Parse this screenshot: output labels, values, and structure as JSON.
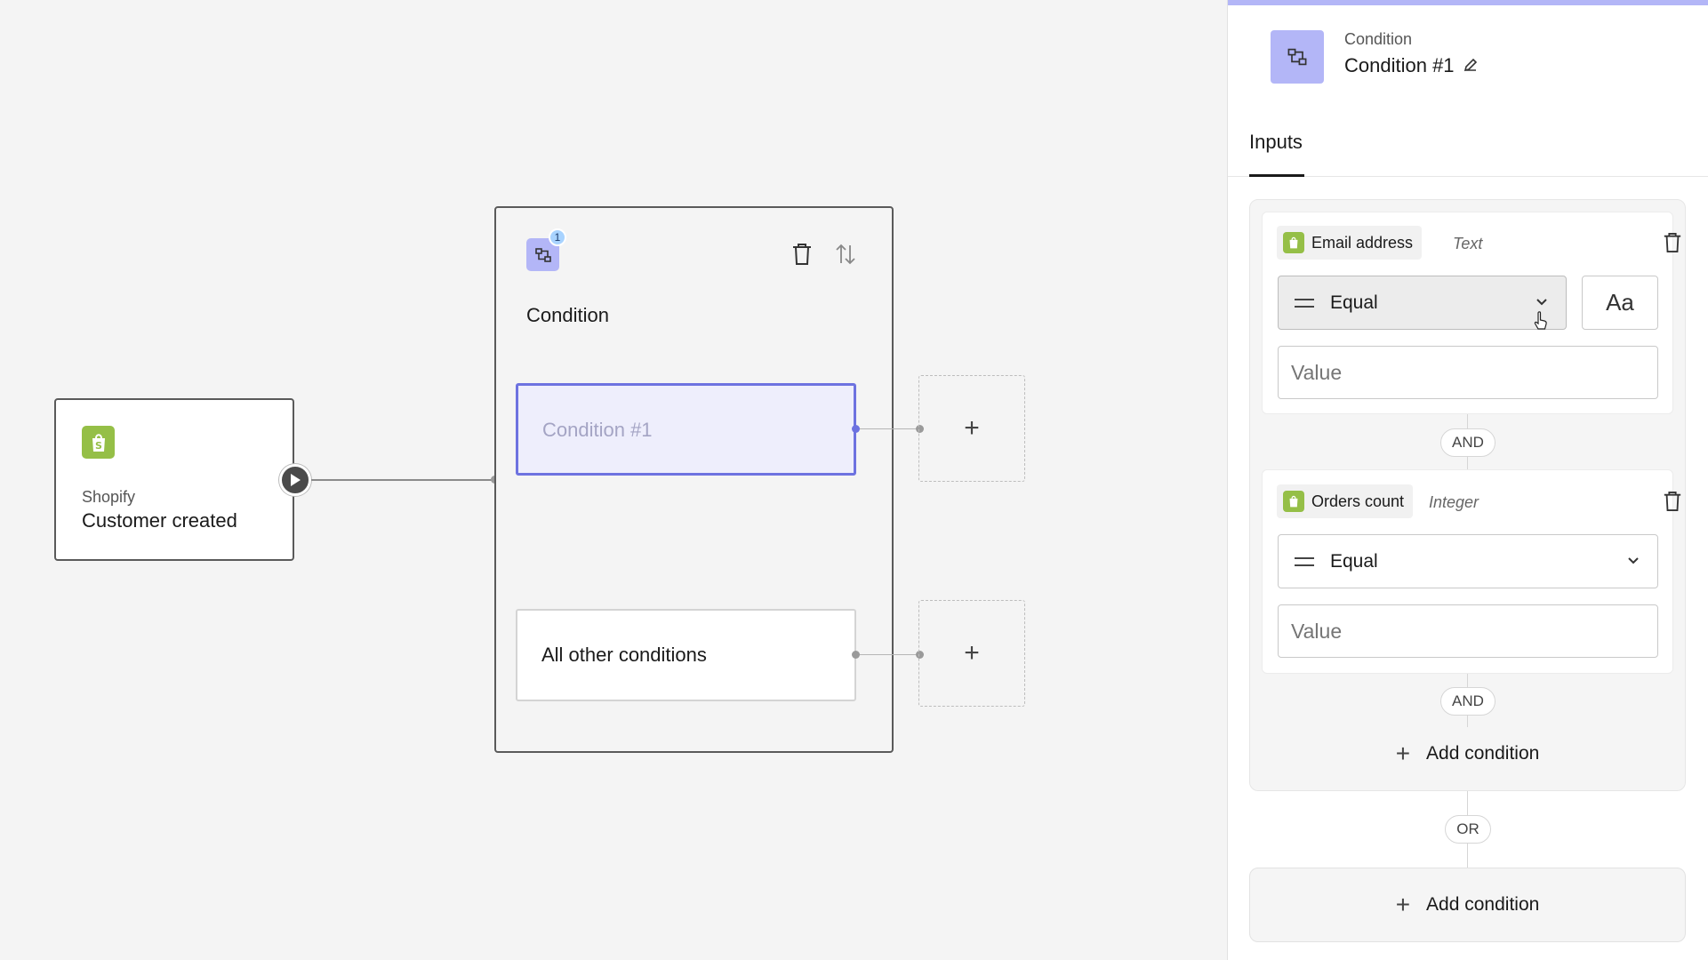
{
  "trigger": {
    "app": "Shopify",
    "event": "Customer created"
  },
  "condition_node": {
    "badge_count": "1",
    "title": "Condition",
    "branches": [
      {
        "label": "Condition #1"
      },
      {
        "label": "All other conditions"
      }
    ]
  },
  "panel": {
    "type_label": "Condition",
    "name": "Condition #1",
    "tabs": [
      {
        "label": "Inputs"
      }
    ],
    "rules": [
      {
        "field": "Email address",
        "field_type": "Text",
        "operator": "Equal",
        "case_toggle": "Aa",
        "value_placeholder": "Value"
      },
      {
        "field": "Orders count",
        "field_type": "Integer",
        "operator": "Equal",
        "value_placeholder": "Value"
      }
    ],
    "and_label": "AND",
    "or_label": "OR",
    "add_condition_label": "Add condition"
  },
  "colors": {
    "shopify_green": "#95bf47",
    "condition_accent": "#b3b6f7",
    "selected_border": "#6d72e0"
  },
  "icons": {
    "shopify": "shopify-bag-icon",
    "condition": "condition-branch-icon",
    "delete": "trash-icon",
    "reorder": "sort-arrows-icon",
    "edit": "pencil-icon",
    "add": "plus-icon",
    "expand": "chevron-down-icon",
    "run": "play-icon",
    "cursor": "pointer-hand-icon"
  }
}
